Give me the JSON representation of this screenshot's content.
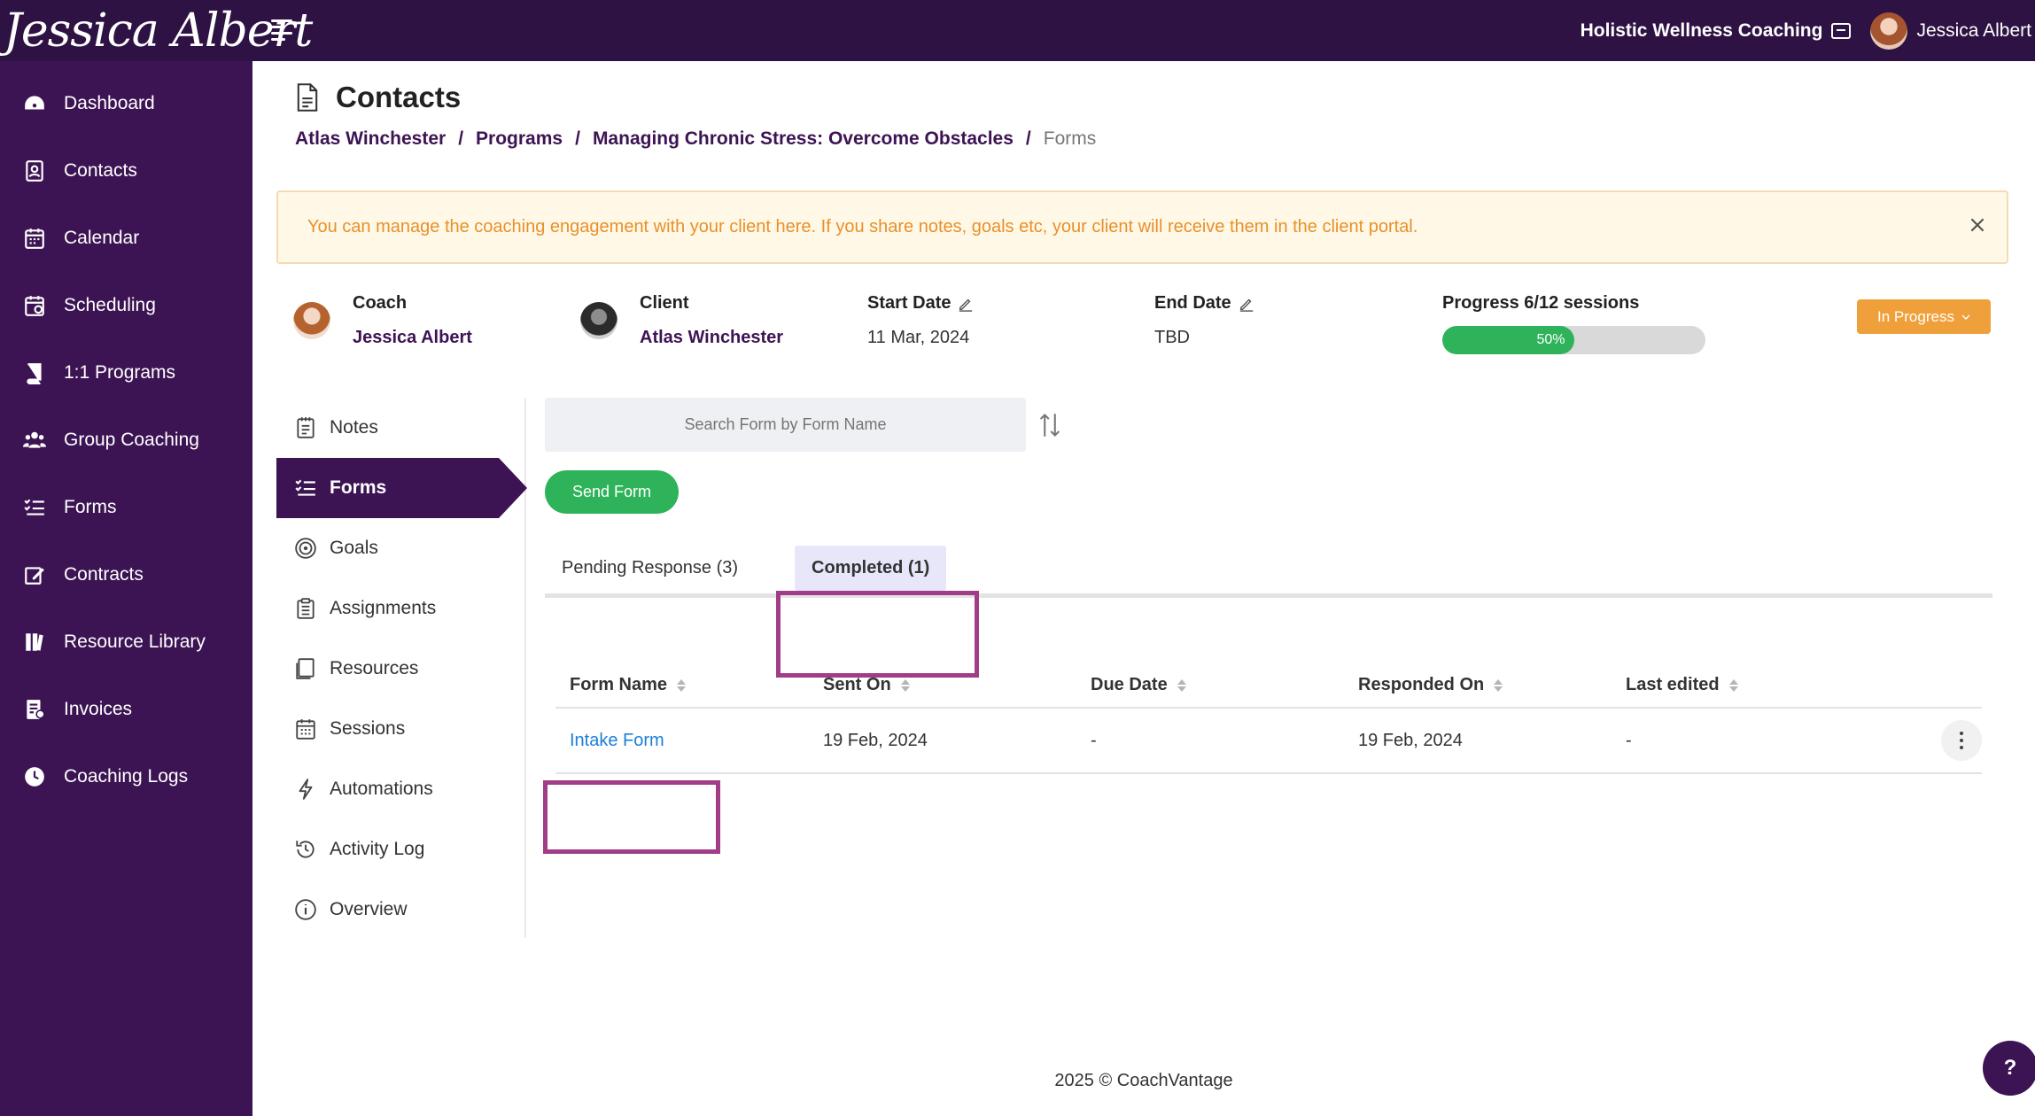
{
  "brand": {
    "name": "Jessica Albert"
  },
  "topbar": {
    "org_name": "Holistic Wellness Coaching",
    "user_name": "Jessica Albert"
  },
  "sidebar": {
    "items": [
      {
        "label": "Dashboard",
        "icon": "dashboard-icon"
      },
      {
        "label": "Contacts",
        "icon": "contacts-icon"
      },
      {
        "label": "Calendar",
        "icon": "calendar-icon"
      },
      {
        "label": "Scheduling",
        "icon": "scheduling-icon"
      },
      {
        "label": "1:1 Programs",
        "icon": "book-icon"
      },
      {
        "label": "Group Coaching",
        "icon": "group-icon"
      },
      {
        "label": "Forms",
        "icon": "forms-icon"
      },
      {
        "label": "Contracts",
        "icon": "contract-icon"
      },
      {
        "label": "Resource Library",
        "icon": "library-icon"
      },
      {
        "label": "Invoices",
        "icon": "invoice-icon"
      },
      {
        "label": "Coaching Logs",
        "icon": "clock-icon"
      }
    ]
  },
  "page": {
    "title": "Contacts"
  },
  "breadcrumb": [
    "Atlas Winchester",
    "Programs",
    "Managing Chronic Stress: Overcome Obstacles",
    "Forms"
  ],
  "breadcrumb_sep": "/",
  "alert": {
    "text": "You can manage the coaching engagement with your client here. If you share notes, goals etc, your client will receive them in the client portal."
  },
  "engagement": {
    "coach_label": "Coach",
    "coach_name": "Jessica Albert",
    "client_label": "Client",
    "client_name": "Atlas Winchester",
    "start_label": "Start Date",
    "start_value": "11 Mar, 2024",
    "end_label": "End Date",
    "end_value": "TBD",
    "progress_label": "Progress 6/12 sessions",
    "progress_text": "50%",
    "progress_fraction": 0.5,
    "status": "In Progress"
  },
  "subnav": {
    "items": [
      {
        "label": "Notes",
        "icon": "notes-icon"
      },
      {
        "label": "Forms",
        "icon": "forms-icon"
      },
      {
        "label": "Goals",
        "icon": "target-icon"
      },
      {
        "label": "Assignments",
        "icon": "clipboard-icon"
      },
      {
        "label": "Resources",
        "icon": "resources-icon"
      },
      {
        "label": "Sessions",
        "icon": "sessions-icon"
      },
      {
        "label": "Automations",
        "icon": "bolt-icon"
      },
      {
        "label": "Activity Log",
        "icon": "history-icon"
      },
      {
        "label": "Overview",
        "icon": "info-icon"
      }
    ],
    "active": "Forms"
  },
  "forms": {
    "search_placeholder": "Search Form by Form Name",
    "send_label": "Send Form",
    "tabs": [
      {
        "label": "Pending Response (3)"
      },
      {
        "label": "Completed (1)"
      }
    ],
    "active_tab": "Completed (1)",
    "columns": [
      "Form Name",
      "Sent On",
      "Due Date",
      "Responded On",
      "Last edited"
    ],
    "rows": [
      {
        "name": "Intake Form",
        "sent_on": "19 Feb, 2024",
        "due": "-",
        "responded": "19 Feb, 2024",
        "edited": "-"
      }
    ]
  },
  "footer": {
    "text": "2025 © CoachVantage"
  },
  "help": {
    "label": "?"
  },
  "colors": {
    "primary": "#3d1453",
    "topbar": "#2e1243",
    "success": "#2fb35a",
    "warning": "#f0a03a",
    "highlight": "#a13c87",
    "link": "#1c7fd6"
  }
}
